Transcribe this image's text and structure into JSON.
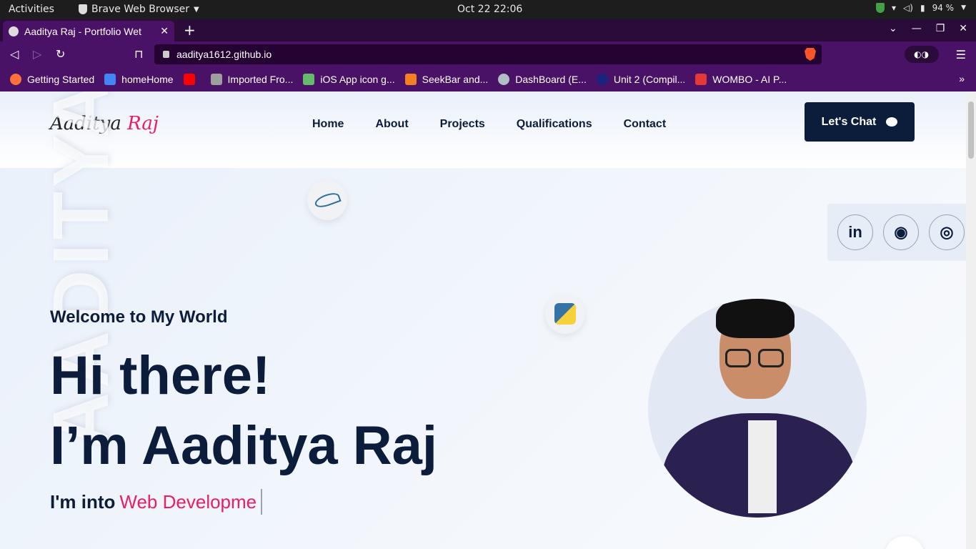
{
  "system": {
    "activities": "Activities",
    "app_name": "Brave Web Browser",
    "clock": "Oct 22  22:06",
    "battery": "94 %"
  },
  "browser": {
    "tab_title": "Aaditya Raj - Portfolio Wet",
    "url": "aaditya1612.github.io",
    "bookmarks": [
      {
        "label": "Getting Started",
        "color": "#ff7139"
      },
      {
        "label": "homeHome",
        "color": "#4285f4"
      },
      {
        "label": "",
        "color": "#ff0000"
      },
      {
        "label": "Imported Fro...",
        "color": "#9e9e9e"
      },
      {
        "label": "iOS App icon g...",
        "color": "#66bb6a"
      },
      {
        "label": "SeekBar and...",
        "color": "#f48024"
      },
      {
        "label": "DashBoard (E...",
        "color": "#b0bec5"
      },
      {
        "label": "Unit 2 (Compil...",
        "color": "#1a237e"
      },
      {
        "label": "WOMBO - AI P...",
        "color": "#e53935"
      }
    ]
  },
  "site": {
    "logo_first": "Aaditya",
    "logo_last": "Raj",
    "nav": [
      "Home",
      "About",
      "Projects",
      "Qualifications",
      "Contact"
    ],
    "cta": "Let's Chat",
    "bg_word": "AADITYA",
    "social": [
      {
        "icon": "linkedin-icon",
        "glyph": "in"
      },
      {
        "icon": "github-icon",
        "glyph": "◉"
      },
      {
        "icon": "instagram-icon",
        "glyph": "◎"
      }
    ],
    "welcome": "Welcome to My World",
    "hi": "Hi there!",
    "name": "I’m Aaditya Raj",
    "into_prefix": "I'm into",
    "into_skill": "Web Developme"
  }
}
